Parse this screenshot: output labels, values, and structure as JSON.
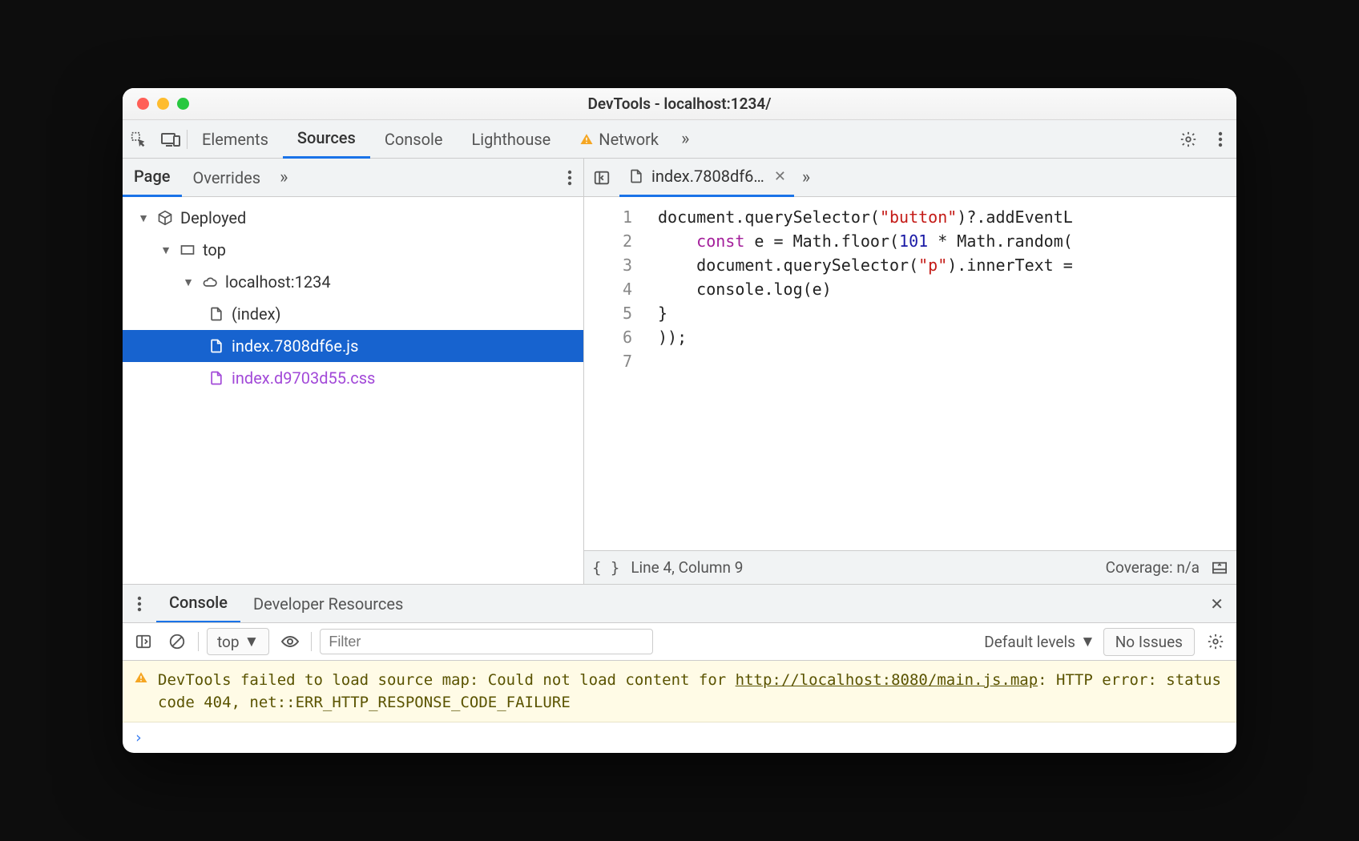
{
  "window": {
    "title": "DevTools - localhost:1234/"
  },
  "main_tabs": {
    "elements": "Elements",
    "sources": "Sources",
    "console": "Console",
    "lighthouse": "Lighthouse",
    "network": "Network"
  },
  "sources_sidebar_tabs": {
    "page": "Page",
    "overrides": "Overrides"
  },
  "open_file_tab": "index.7808df6…",
  "tree": {
    "deployed": "Deployed",
    "top": "top",
    "host": "localhost:1234",
    "files": [
      "(index)",
      "index.7808df6e.js",
      "index.d9703d55.css"
    ]
  },
  "code": {
    "lines": [
      "1",
      "2",
      "3",
      "4",
      "5",
      "6",
      "7"
    ],
    "l1_a": "document.querySelector(",
    "l1_b": "\"button\"",
    "l1_c": ")?.addEventL",
    "l2_a": "    const",
    "l2_b": " e = Math.floor(",
    "l2_c": "101",
    "l2_d": " * Math.random(",
    "l3_a": "    document.querySelector(",
    "l3_b": "\"p\"",
    "l3_c": ").innerText =",
    "l4": "    console.log(e)",
    "l5": "}",
    "l6": "));",
    "l7": ""
  },
  "status": {
    "pos": "Line 4, Column 9",
    "coverage": "Coverage: n/a"
  },
  "drawer": {
    "console": "Console",
    "devres": "Developer Resources"
  },
  "console_toolbar": {
    "context": "top",
    "filter_placeholder": "Filter",
    "levels": "Default levels",
    "issues": "No Issues"
  },
  "warning": {
    "pre": "DevTools failed to load source map: Could not load content for ",
    "link": "http://localhost:8080/main.js.map",
    "post": ": HTTP error: status code 404, net::ERR_HTTP_RESPONSE_CODE_FAILURE"
  },
  "prompt": "›"
}
